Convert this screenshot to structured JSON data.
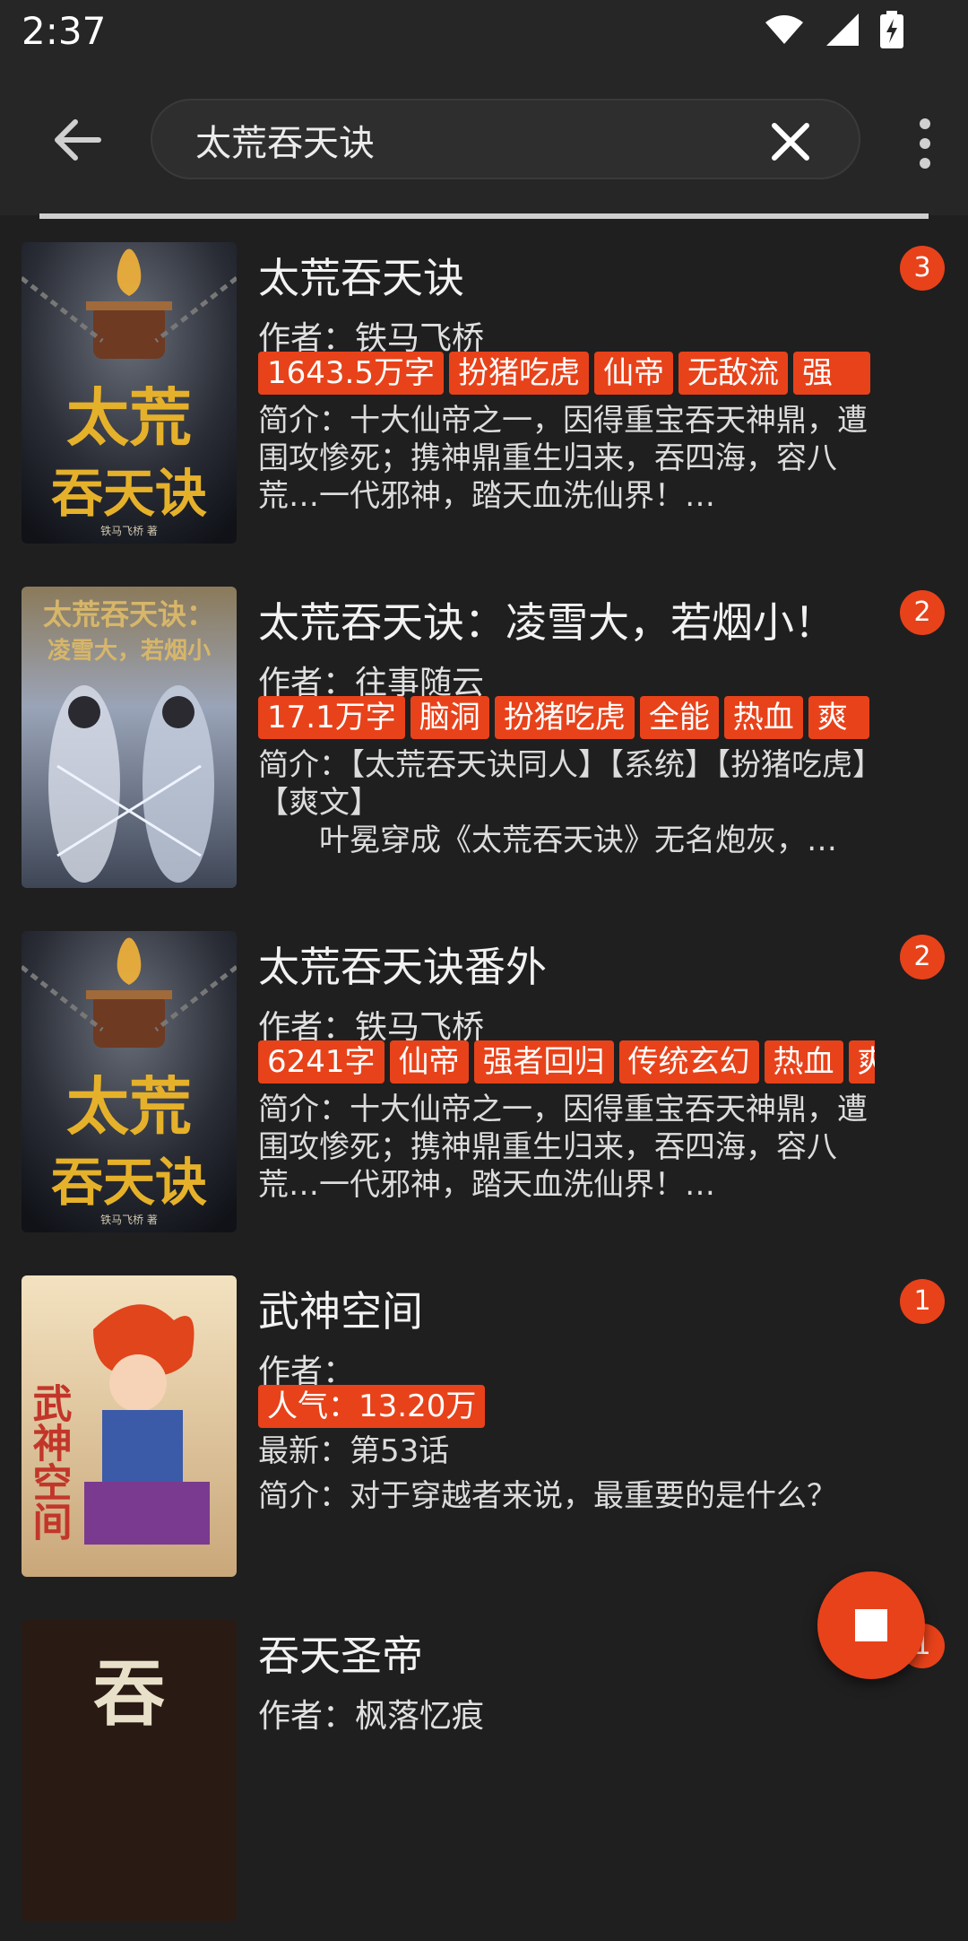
{
  "status": {
    "time": "2:37"
  },
  "search": {
    "query": "太荒吞天诀"
  },
  "books": [
    {
      "title": "太荒吞天诀",
      "badge": "3",
      "author": "作者：铁马飞桥",
      "tags": [
        "1643.5万字",
        "扮猪吃虎",
        "仙帝",
        "无敌流",
        "强"
      ],
      "intro": "简介：十大仙帝之一，因得重宝吞天神鼎，遭围攻惨死；携神鼎重生归来，吞四海，容八荒…一代邪神，踏天血洗仙界！…",
      "cover": {
        "text_top": "太荒",
        "text_bottom": "吞天诀",
        "author_mark": "铁马飞桥 著",
        "accent": "#e6b12a"
      }
    },
    {
      "title": "太荒吞天诀：凌雪大，若烟小！",
      "badge": "2",
      "author": "作者：往事随云",
      "tags": [
        "17.1万字",
        "脑洞",
        "扮猪吃虎",
        "全能",
        "热血",
        "爽"
      ],
      "intro": "简介：【太荒吞天诀同人】【系统】【扮猪吃虎】【爽文】\n　　叶冕穿成《太荒吞天诀》无名炮灰，…",
      "cover": {
        "text_top": "太荒吞天诀：",
        "text_bottom": "凌雪大，若烟小",
        "accent": "#d7b66a"
      }
    },
    {
      "title": "太荒吞天诀番外",
      "badge": "2",
      "author": "作者：铁马飞桥",
      "tags": [
        "6241字",
        "仙帝",
        "强者回归",
        "传统玄幻",
        "热血",
        "爽"
      ],
      "intro": "简介：十大仙帝之一，因得重宝吞天神鼎，遭围攻惨死；携神鼎重生归来，吞四海，容八荒…一代邪神，踏天血洗仙界！…",
      "cover": {
        "text_top": "太荒",
        "text_bottom": "吞天诀",
        "author_mark": "铁马飞桥 著",
        "accent": "#e6b12a"
      }
    },
    {
      "title": "武神空间",
      "badge": "1",
      "author": "作者：",
      "tags": [
        "人气：13.20万"
      ],
      "latest": "最新：第53话",
      "intro": "简介：对于穿越者来说，最重要的是什么？",
      "cover": {
        "text_top": "武神空间",
        "accent": "#c2362a"
      }
    },
    {
      "title": "吞天圣帝",
      "badge": "1",
      "author": "作者：枫落忆痕",
      "cover": {
        "text_top": "吞",
        "accent": "#e8e0c8"
      }
    }
  ]
}
